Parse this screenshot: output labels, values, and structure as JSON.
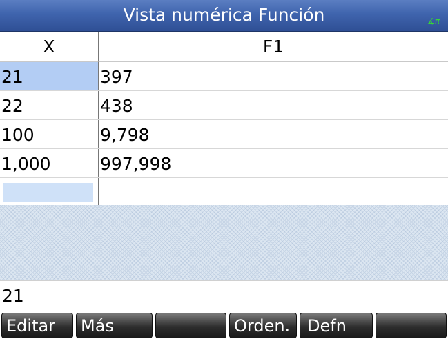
{
  "title": "Vista numérica Función",
  "angle_mode_indicator": "∡π",
  "table": {
    "columns": [
      "X",
      "F1"
    ],
    "rows": [
      {
        "x": "21",
        "f1": "397"
      },
      {
        "x": "22",
        "f1": "438"
      },
      {
        "x": "100",
        "f1": "9,798"
      },
      {
        "x": "1,000",
        "f1": "997,998"
      }
    ],
    "selected_cell": {
      "row": 0,
      "column": "X"
    }
  },
  "entry_line": "21",
  "menu": {
    "buttons": [
      "Editar",
      "Más",
      "",
      "Orden.",
      "Defn",
      ""
    ]
  },
  "colors": {
    "titlebar": "#3f64ad",
    "selection": "#b3cdf4",
    "angle_indicator": "#37d23a",
    "softkey": "#2e2e2e"
  }
}
